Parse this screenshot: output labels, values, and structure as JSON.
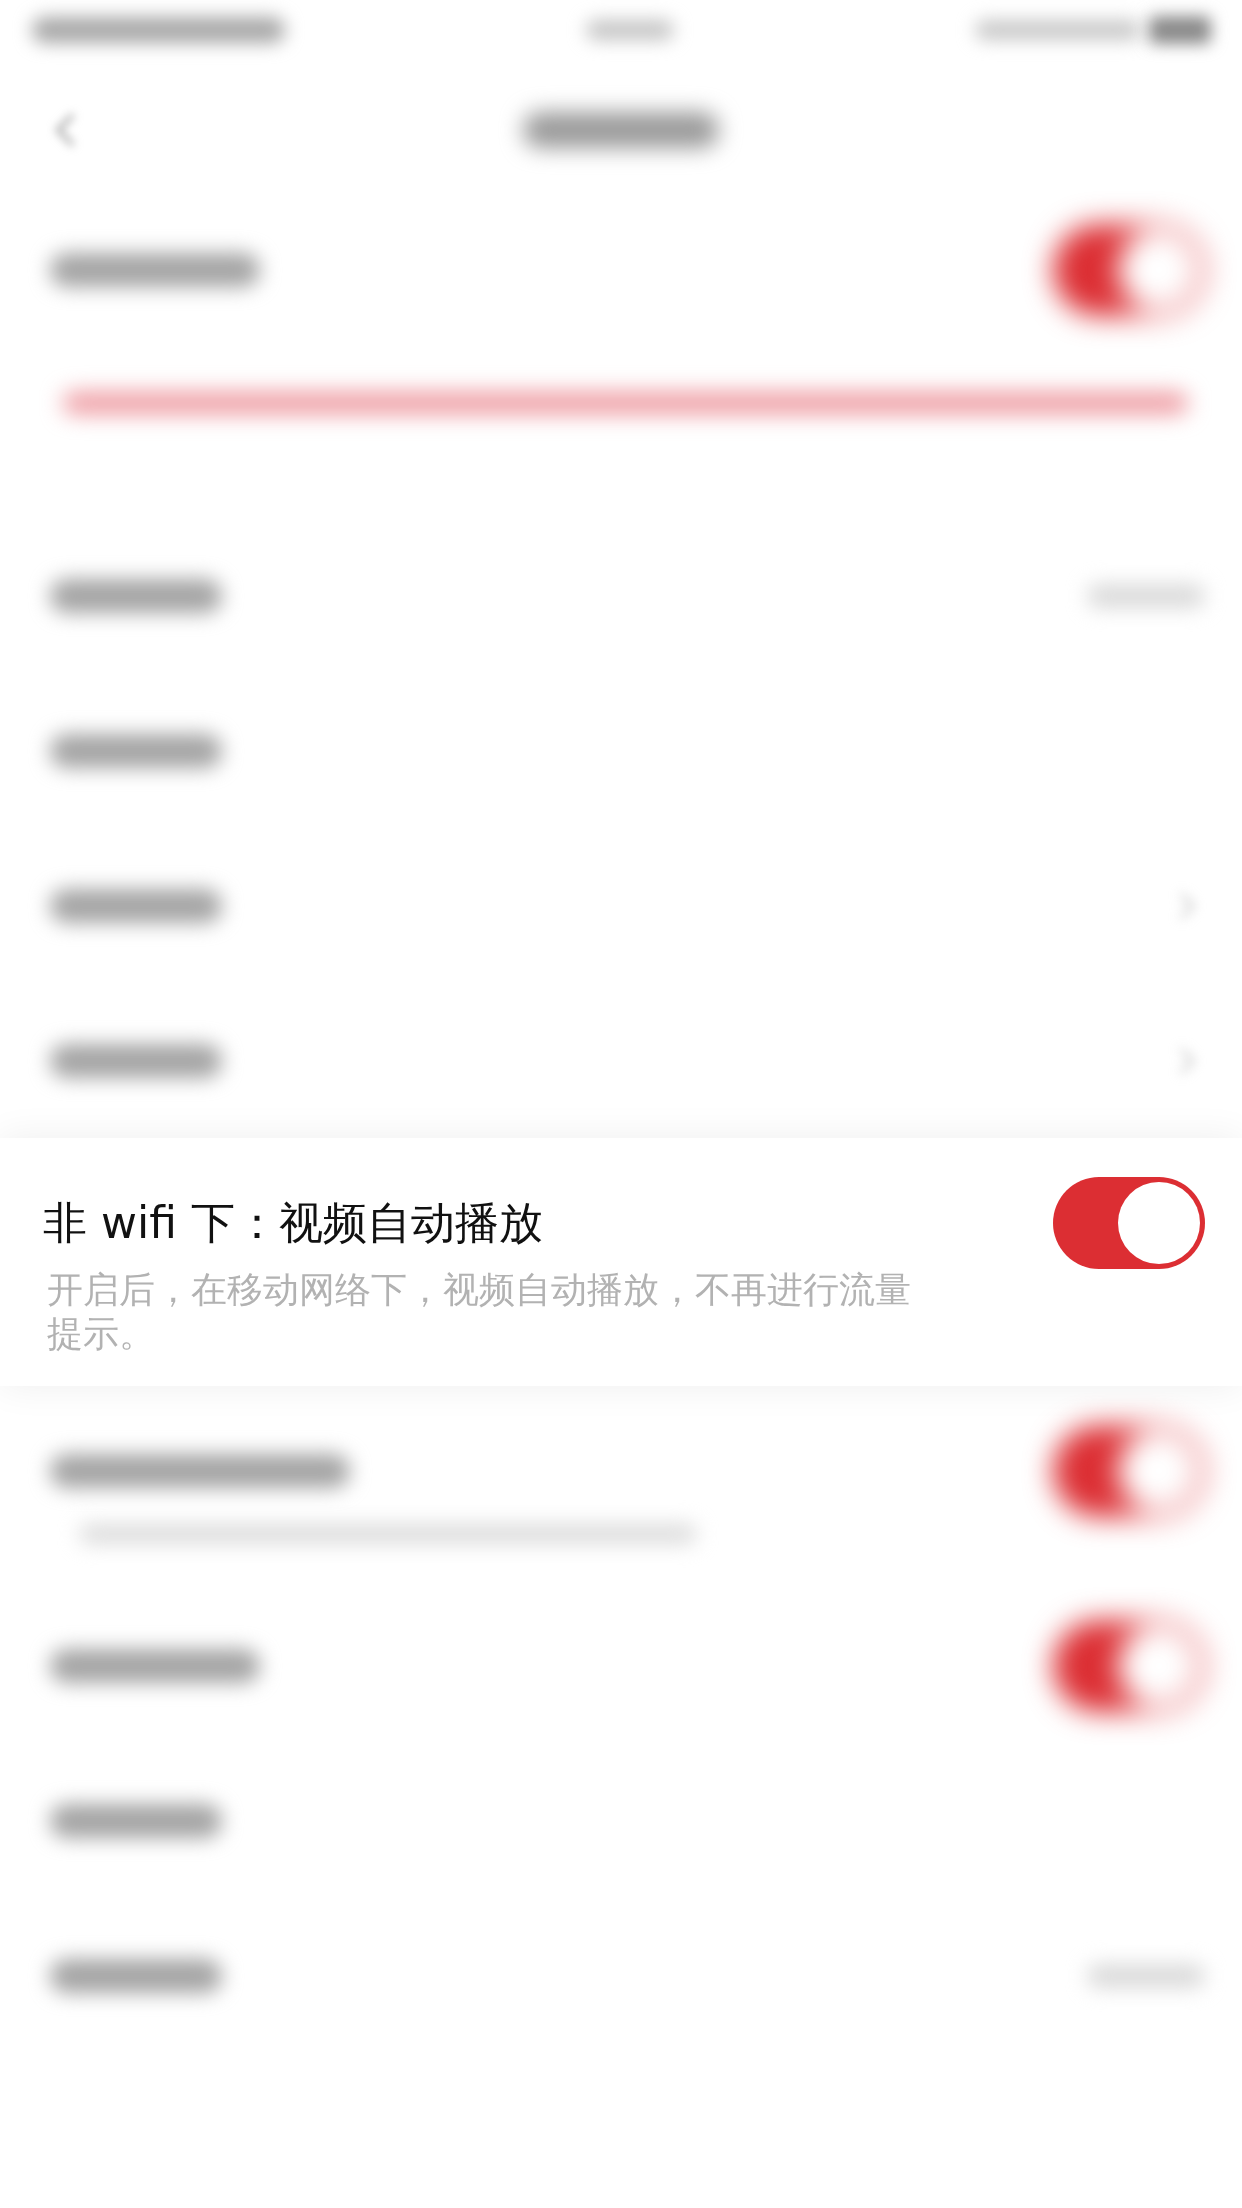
{
  "status_bar": {
    "blurred": true
  },
  "nav_bar": {
    "blurred": true,
    "back_button": true
  },
  "sections": [
    {
      "rows": [
        {
          "kind": "toggle",
          "blurred": true,
          "on": true,
          "note": true,
          "warning": true
        }
      ]
    },
    {
      "rows": [
        {
          "kind": "value",
          "blurred": true
        },
        {
          "kind": "plain",
          "blurred": true
        },
        {
          "kind": "link",
          "blurred": true
        },
        {
          "kind": "link",
          "blurred": true
        },
        {
          "kind": "toggle",
          "blurred": false,
          "on": true,
          "title": "非 wifi 下：视频自动播放",
          "description": "开启后，在移动网络下，视频自动播放，不再进行流量提示。"
        },
        {
          "kind": "toggle",
          "blurred": true,
          "on": true,
          "note": true,
          "warning": false
        },
        {
          "kind": "toggle",
          "blurred": true,
          "on": true
        },
        {
          "kind": "plain",
          "blurred": true
        },
        {
          "kind": "value",
          "blurred": true
        }
      ]
    }
  ]
}
